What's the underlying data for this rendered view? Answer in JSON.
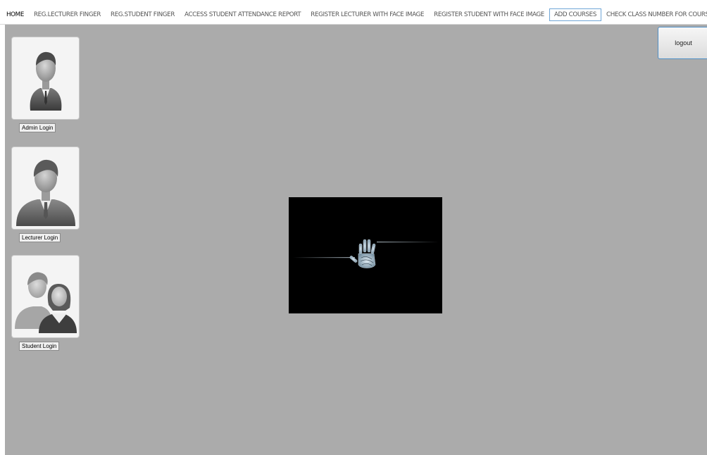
{
  "menu": {
    "items": [
      {
        "label": "HOME"
      },
      {
        "label": "REG.LECTURER FINGER"
      },
      {
        "label": "REG.STUDENT FINGER"
      },
      {
        "label": "ACCESS STUDENT ATTENDANCE REPORT"
      },
      {
        "label": "REGISTER LECTURER WITH FACE IMAGE"
      },
      {
        "label": "REGISTER STUDENT WITH FACE IMAGE"
      },
      {
        "label": "ADD COURSES"
      },
      {
        "label": "CHECK CLASS NUMBER FOR COURS"
      }
    ]
  },
  "logins": {
    "admin_label": "Admin Login",
    "lecturer_label": "Lecturer Login",
    "student_label": "Student Login"
  },
  "logout_label": "logout",
  "colors": {
    "background": "#ababab",
    "focus_border": "#6fa6d6",
    "scanner_bg": "#000000"
  }
}
